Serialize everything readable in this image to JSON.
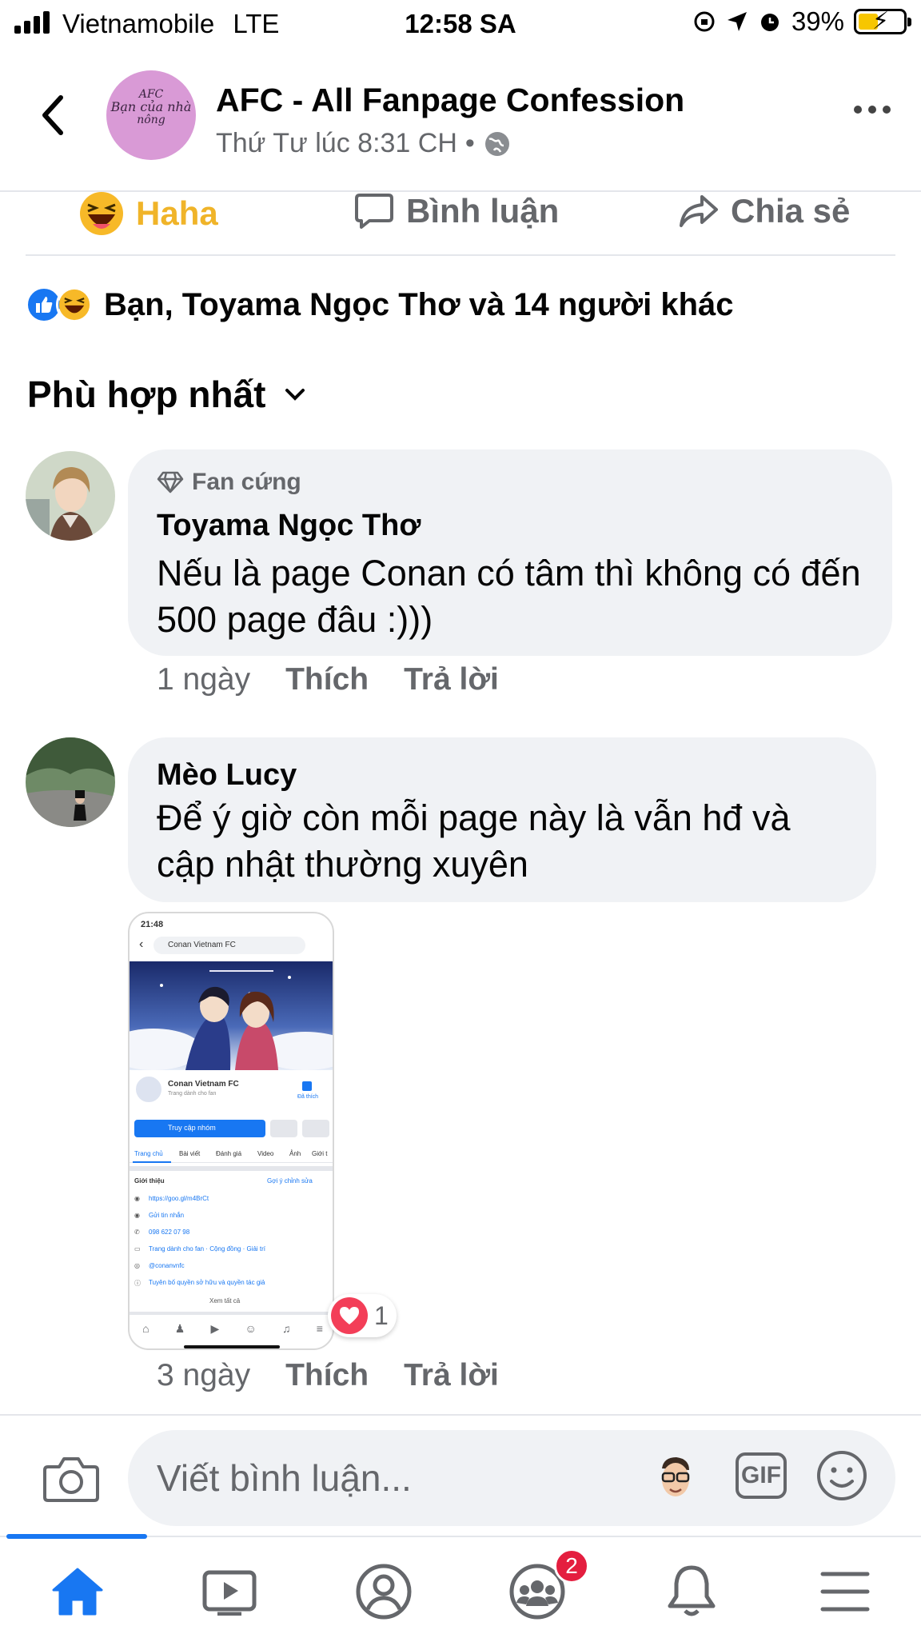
{
  "status_bar": {
    "carrier": "Vietnamobile",
    "network": "LTE",
    "time": "12:58 SA",
    "battery": "39%"
  },
  "header": {
    "page_name": "AFC - All Fanpage Confession",
    "post_time": "Thứ Tư lúc 8:31 CH",
    "separator": "•",
    "avatar_text_1": "AFC",
    "avatar_text_2": "Bạn của nhà",
    "avatar_text_3": "nông"
  },
  "actions": {
    "haha": "Haha",
    "comment": "Bình luận",
    "share": "Chia sẻ"
  },
  "reactions_summary": "Bạn, Toyama Ngọc Thơ và 14 người khác",
  "sort_label": "Phù hợp nhất",
  "comments": [
    {
      "badge": "Fan cứng",
      "author": "Toyama Ngọc Thơ",
      "text": "Nếu  là page Conan có tâm thì không có đến 500 page đâu :)))",
      "time": "1 ngày",
      "like": "Thích",
      "reply": "Trả lời"
    },
    {
      "author": "Mèo Lucy",
      "text": "Để ý giờ còn mỗi page này là vẫn hđ và cập nhật thường xuyên",
      "time": "3 ngày",
      "like": "Thích",
      "reply": "Trả lời",
      "reaction_count": "1"
    }
  ],
  "attachment": {
    "time": "21:48",
    "search": "Conan Vietnam FC",
    "page_name": "Conan Vietnam FC",
    "page_desc": "Trang dành cho fan",
    "liked": "Đã thích",
    "visit_button": "Truy cập nhóm",
    "tabs": [
      "Trang chủ",
      "Bài viết",
      "Đánh giá",
      "Video",
      "Ảnh",
      "Giới t"
    ],
    "intro": "Giới thiệu",
    "suggest_edit": "Gợi ý chỉnh sửa",
    "info": [
      "https://goo.gl/m4BrCt",
      "Gửi tin nhắn",
      "098 622 07 98",
      "Trang dành cho fan · Cộng đồng · Giải trí",
      "@conanvnfc",
      "Tuyên bố quyền sở hữu và quyền tác giả"
    ],
    "see_all": "Xem tất cả"
  },
  "composer": {
    "placeholder": "Viết bình luận...",
    "gif": "GIF"
  },
  "bottom_nav": {
    "groups_badge": "2"
  },
  "colors": {
    "accent": "#1877f2",
    "haha": "#f0b429",
    "secondary_text": "#65676b",
    "bubble": "#f0f2f5",
    "badge_red": "#e41e3f"
  }
}
